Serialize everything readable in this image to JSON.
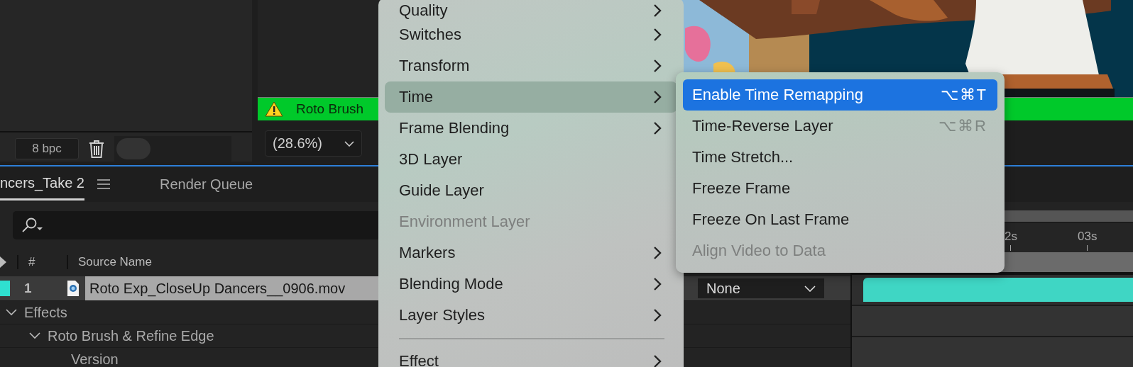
{
  "left_panel": {
    "bit_depth": "8 bpc",
    "toggle_on": false
  },
  "viewer": {
    "warning": "Roto Brush",
    "zoom": "(28.6%)"
  },
  "timeline": {
    "tabs": [
      {
        "label": "ncers_Take 2",
        "selected": true
      },
      {
        "label": "Render Queue",
        "selected": false
      }
    ],
    "columns": [
      "#",
      "Source Name"
    ],
    "layer": {
      "number": "1",
      "source_name": "Roto Exp_CloseUp Dancers__0906.mov",
      "color": "#2fe0d0",
      "selected": true,
      "parent": "None"
    },
    "tree": [
      {
        "label": "Effects",
        "expanded": true,
        "children": [
          {
            "label": "Roto Brush & Refine Edge",
            "expanded": true,
            "children": [
              {
                "label": "Version"
              }
            ]
          }
        ]
      }
    ],
    "ruler": [
      "2s",
      "03s"
    ]
  },
  "context_menu": {
    "items": [
      {
        "kind": "item",
        "label": "Quality",
        "submenu": true,
        "disabled": false,
        "selected": false
      },
      {
        "kind": "item",
        "label": "Switches",
        "submenu": true,
        "disabled": false,
        "selected": false
      },
      {
        "kind": "item",
        "label": "Transform",
        "submenu": true,
        "disabled": false,
        "selected": false
      },
      {
        "kind": "item",
        "label": "Time",
        "submenu": true,
        "disabled": false,
        "selected": true
      },
      {
        "kind": "item",
        "label": "Frame Blending",
        "submenu": true,
        "disabled": false,
        "selected": false
      },
      {
        "kind": "item",
        "label": "3D Layer",
        "submenu": false,
        "disabled": false,
        "selected": false
      },
      {
        "kind": "item",
        "label": "Guide Layer",
        "submenu": false,
        "disabled": false,
        "selected": false
      },
      {
        "kind": "item",
        "label": "Environment Layer",
        "submenu": false,
        "disabled": true,
        "selected": false
      },
      {
        "kind": "item",
        "label": "Markers",
        "submenu": true,
        "disabled": false,
        "selected": false
      },
      {
        "kind": "item",
        "label": "Blending Mode",
        "submenu": true,
        "disabled": false,
        "selected": false
      },
      {
        "kind": "item",
        "label": "Layer Styles",
        "submenu": true,
        "disabled": false,
        "selected": false
      },
      {
        "kind": "separator"
      },
      {
        "kind": "item",
        "label": "Effect",
        "submenu": true,
        "disabled": false,
        "selected": false
      }
    ]
  },
  "time_submenu": {
    "items": [
      {
        "label": "Enable Time Remapping",
        "shortcut": "⌥⌘T",
        "disabled": false,
        "selected": true
      },
      {
        "label": "Time-Reverse Layer",
        "shortcut": "⌥⌘R",
        "disabled": false,
        "selected": false
      },
      {
        "label": "Time Stretch...",
        "disabled": false,
        "selected": false
      },
      {
        "label": "Freeze Frame",
        "disabled": false,
        "selected": false
      },
      {
        "label": "Freeze On Last Frame",
        "disabled": false,
        "selected": false
      },
      {
        "label": "Align Video to Data",
        "disabled": true,
        "selected": false
      }
    ]
  }
}
